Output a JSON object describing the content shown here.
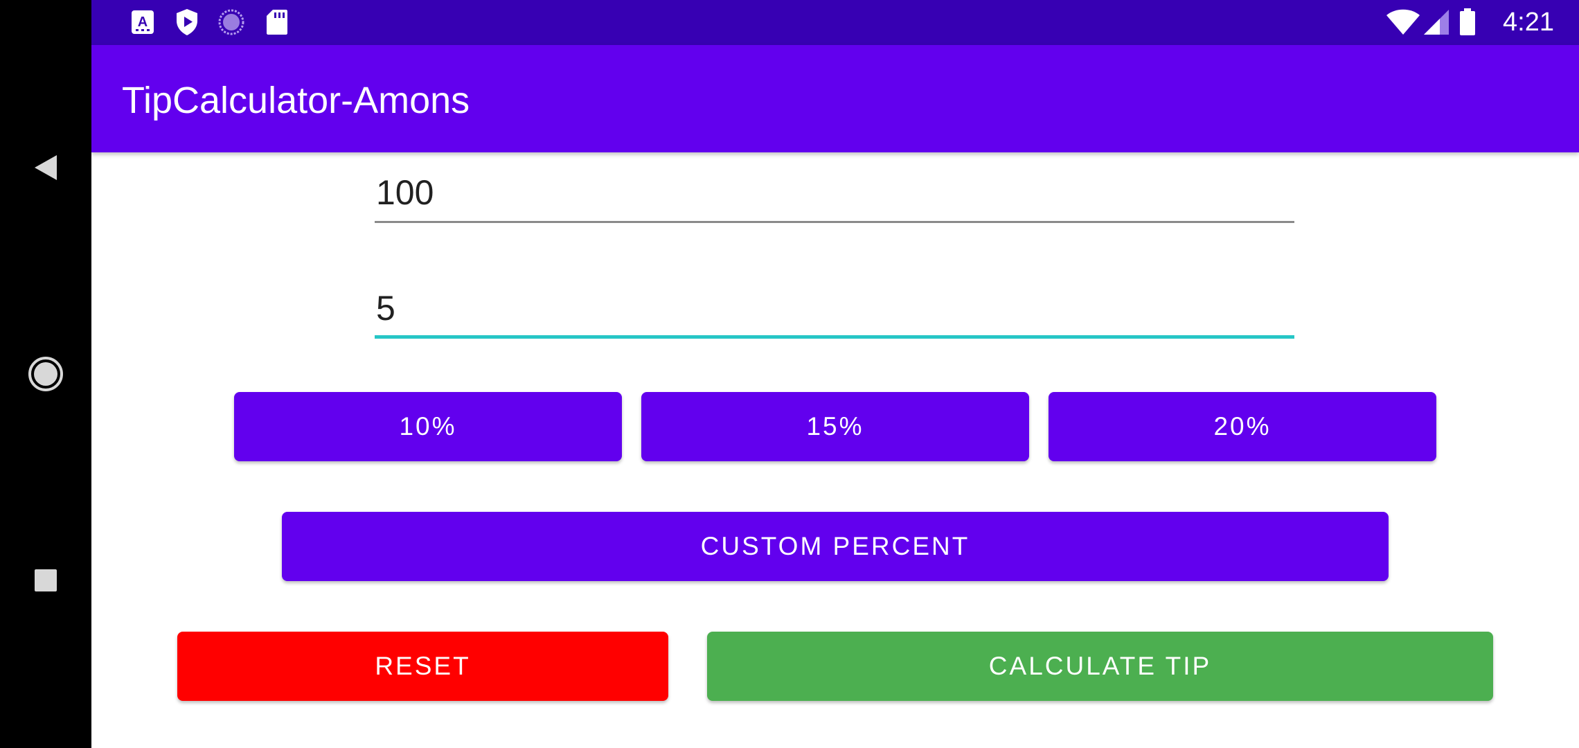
{
  "status_bar": {
    "time": "4:21",
    "left_icons": [
      "keyboard-a-icon",
      "shield-play-icon",
      "loading-circle-icon",
      "sd-card-icon"
    ],
    "right_icons": [
      "wifi-icon",
      "cell-signal-icon",
      "battery-icon"
    ]
  },
  "app_bar": {
    "title": "TipCalculator-Amons",
    "color": "#6200ee"
  },
  "form": {
    "bill_amount": "100",
    "custom_percent": "5",
    "focus_color": "#26c6c6"
  },
  "percent_buttons": [
    "10%",
    "15%",
    "20%"
  ],
  "custom_button": "CUSTOM PERCENT",
  "reset_button": {
    "label": "RESET",
    "color": "#ff0000"
  },
  "calculate_button": {
    "label": "CALCULATE TIP",
    "color": "#4caf50"
  },
  "nav_bar": {
    "buttons": [
      "back-icon",
      "home-icon",
      "recents-icon"
    ]
  }
}
